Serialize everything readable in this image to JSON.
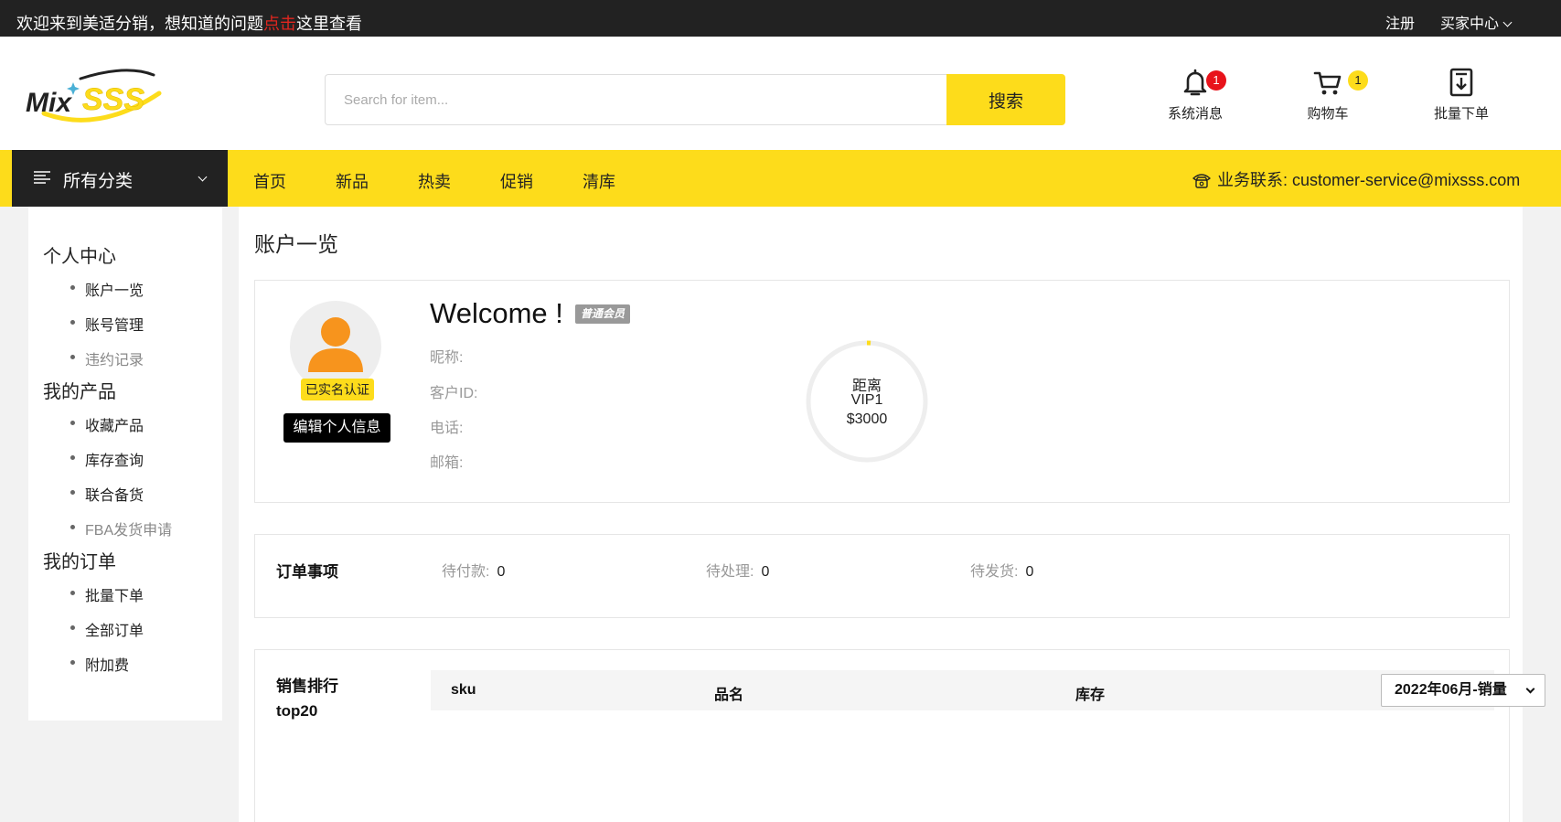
{
  "topbar": {
    "welcome_prefix": "欢迎来到美适分销，想知道的问题",
    "welcome_link": "点击",
    "welcome_suffix": "这里查看",
    "register": "注册",
    "buyer_center": "买家中心"
  },
  "header": {
    "logo_text_mix": "Mix",
    "logo_text_sss": "SSS",
    "search_placeholder": "Search for item...",
    "search_button": "搜索",
    "messages": {
      "label": "系统消息",
      "count": "1"
    },
    "cart": {
      "label": "购物车",
      "count": "1"
    },
    "bulk_order": {
      "label": "批量下单"
    }
  },
  "nav": {
    "all_categories": "所有分类",
    "links": [
      "首页",
      "新品",
      "热卖",
      "促销",
      "清库"
    ],
    "contact": "业务联系: customer-service@mixsss.com"
  },
  "sidebar": {
    "groups": [
      {
        "title": "个人中心",
        "items": [
          "账户一览",
          "账号管理",
          "违约记录"
        ]
      },
      {
        "title": "我的产品",
        "items": [
          "收藏产品",
          "库存查询",
          "联合备货",
          "FBA发货申请"
        ]
      },
      {
        "title": "我的订单",
        "items": [
          "批量下单",
          "全部订单",
          "附加费"
        ]
      }
    ]
  },
  "main": {
    "page_title": "账户一览",
    "profile": {
      "verified": "已实名认证",
      "edit_button": "编辑个人信息",
      "welcome": "Welcome !",
      "member_level": "普通会员",
      "nickname_label": "昵称:",
      "customer_id_label": "客户ID:",
      "phone_label": "电话:",
      "email_label": "邮箱:"
    },
    "vip_progress": {
      "line1": "距离",
      "line2": "VIP1",
      "line3": "$3000",
      "progress": 0.01
    },
    "order_status": {
      "title": "订单事项",
      "pending_payment_label": "待付款:",
      "pending_payment": "0",
      "processing_label": "待处理:",
      "processing": "0",
      "pending_shipment_label": "待发货:",
      "pending_shipment": "0"
    },
    "sales_ranking": {
      "title_line1": "销售排行",
      "title_line2": "top20",
      "col_sku": "sku",
      "col_name": "品名",
      "col_stock": "库存",
      "month_select": "2022年06月-销量"
    }
  },
  "colors": {
    "accent": "#fddc1b",
    "dark": "#222222",
    "badge_red": "#e8131b",
    "avatar_orange": "#f7941d"
  }
}
